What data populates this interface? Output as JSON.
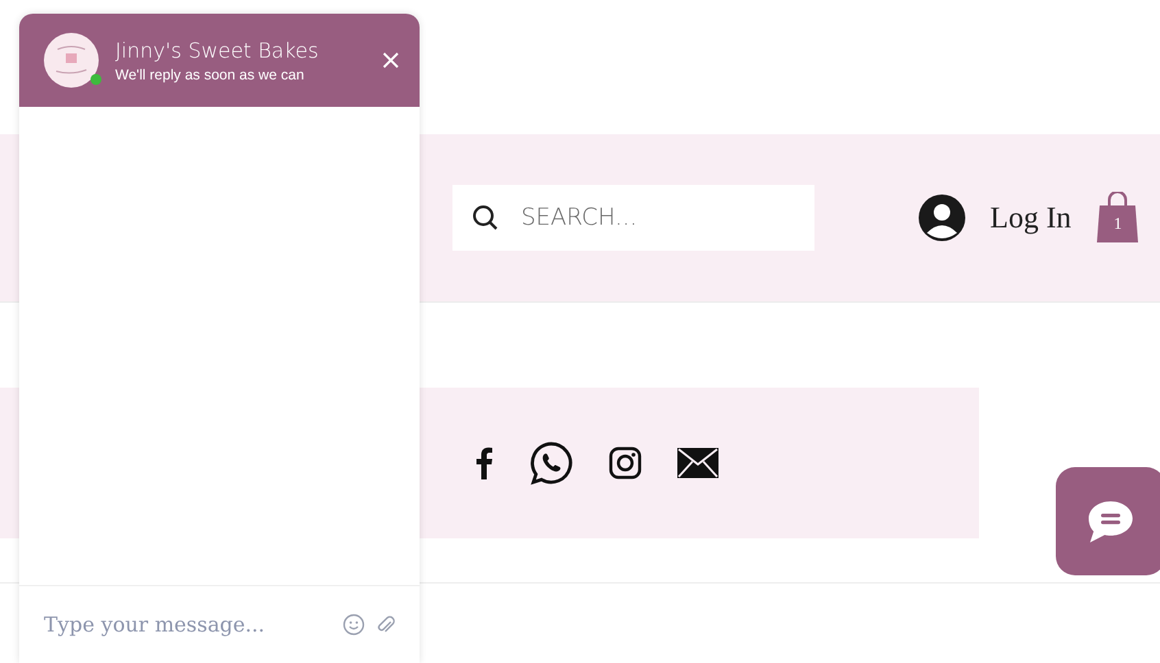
{
  "header": {
    "search": {
      "placeholder": "SEARCH..."
    },
    "login": "Log In",
    "cart_count": "1"
  },
  "chat": {
    "title": "Jinny's Sweet Bakes",
    "subtitle": "We'll reply as soon as we can",
    "online": true,
    "message": {
      "placeholder": "Type your message..."
    }
  }
}
